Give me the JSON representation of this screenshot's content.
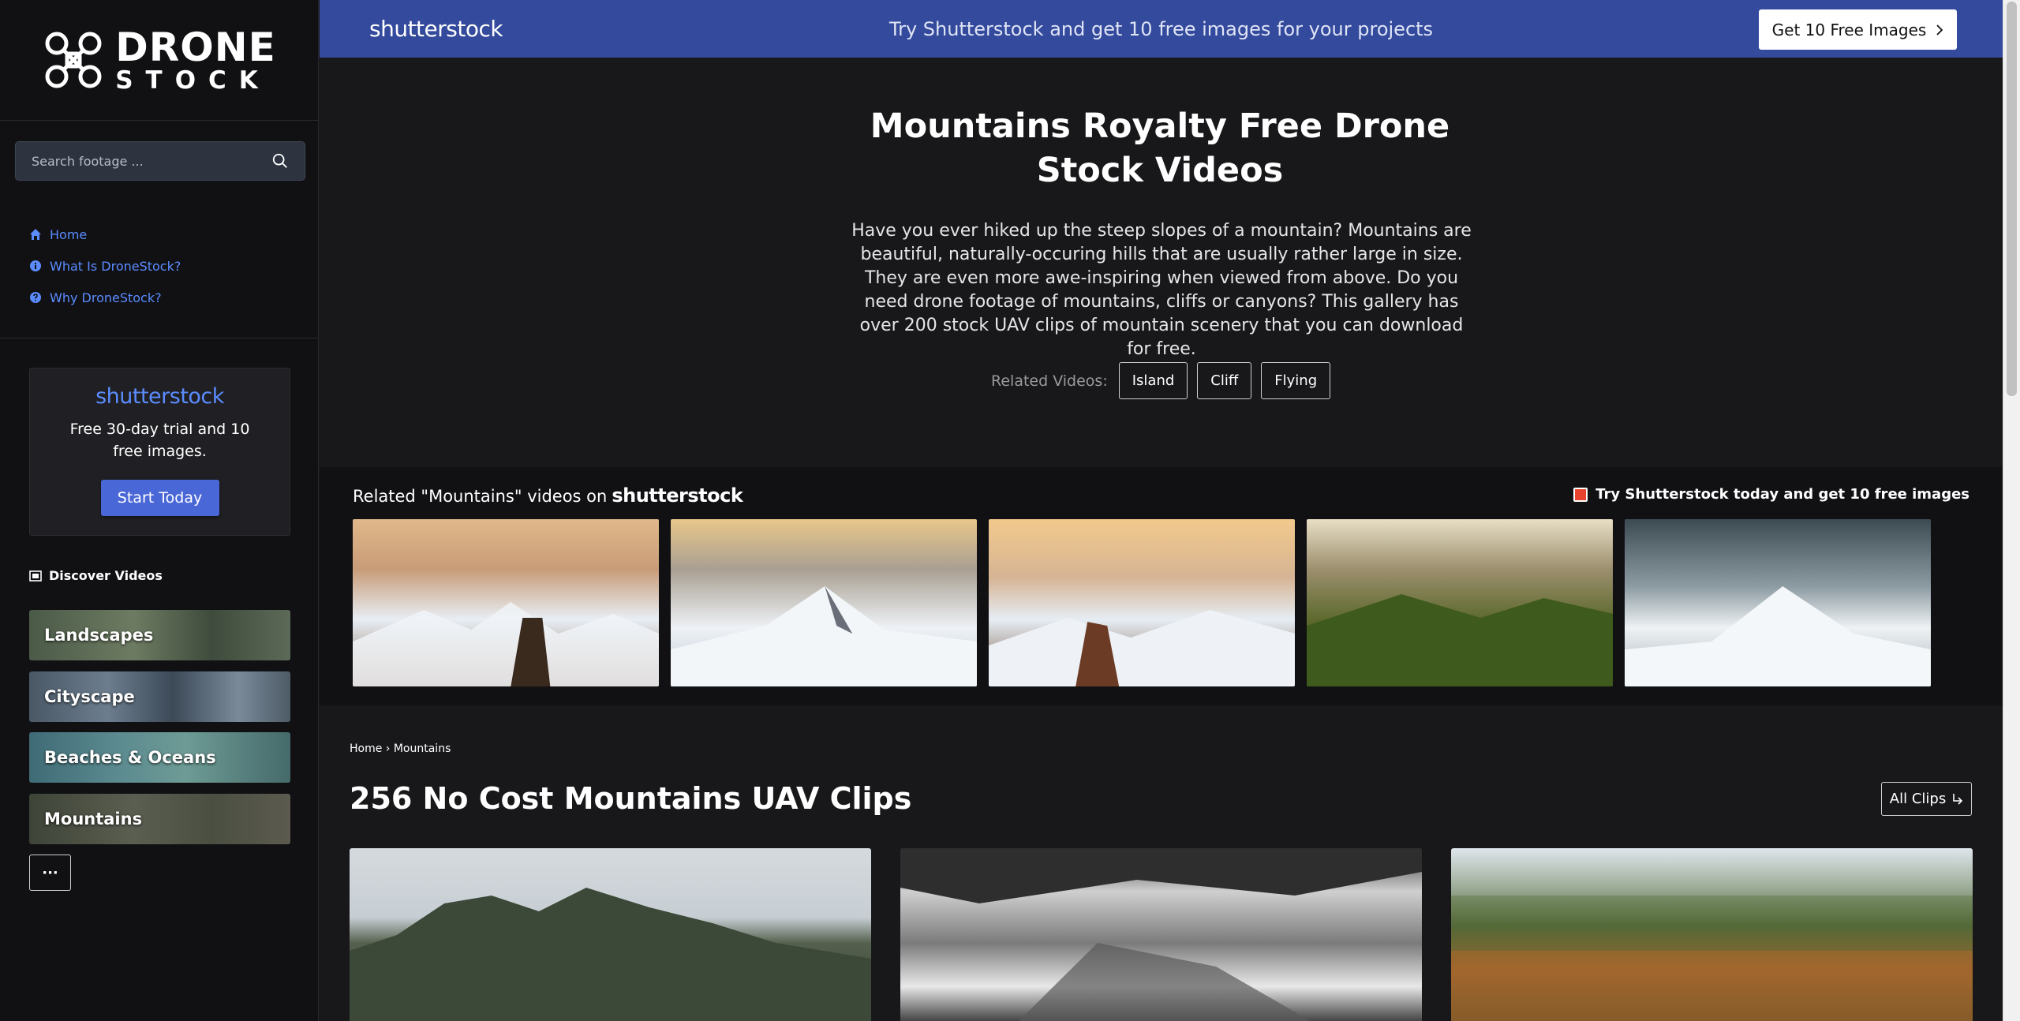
{
  "logo": {
    "line1": "DRONE",
    "line2": "STOCK"
  },
  "search": {
    "placeholder": "Search footage ..."
  },
  "nav": [
    {
      "label": "Home",
      "icon": "home-icon"
    },
    {
      "label": "What Is DroneStock?",
      "icon": "info-icon"
    },
    {
      "label": "Why DroneStock?",
      "icon": "question-icon"
    }
  ],
  "promo": {
    "brand": "shutterstock",
    "text": "Free 30-day trial and 10 free images.",
    "button": "Start Today"
  },
  "discover": {
    "label": "Discover Videos",
    "icon": "film-icon"
  },
  "categories": [
    "Landscapes",
    "Cityscape",
    "Beaches & Oceans",
    "Mountains"
  ],
  "more_button": "···",
  "topbar": {
    "brand": "shutterstock",
    "message": "Try Shutterstock and get 10 free images for your projects",
    "cta": "Get 10 Free Images"
  },
  "hero": {
    "title": "Mountains Royalty Free Drone Stock Videos",
    "description": "Have you ever hiked up the steep slopes of a mountain? Mountains are beautiful, naturally-occuring hills that are usually rather large in size. They are even more awe-inspiring when viewed from above. Do you need drone footage of mountains, cliffs or canyons? This gallery has over 200 stock UAV clips of mountain scenery that you can download for free.",
    "related_label": "Related Videos:",
    "related_tags": [
      "Island",
      "Cliff",
      "Flying"
    ]
  },
  "shutterstock_section": {
    "heading": "Related \"Mountains\" videos on",
    "brand": "shutterstock",
    "try_text": "Try Shutterstock today and get 10 free images"
  },
  "breadcrumb": "Home › Mountains",
  "clips_section": {
    "title": "256 No Cost Mountains UAV Clips",
    "all_clips": "All Clips"
  }
}
